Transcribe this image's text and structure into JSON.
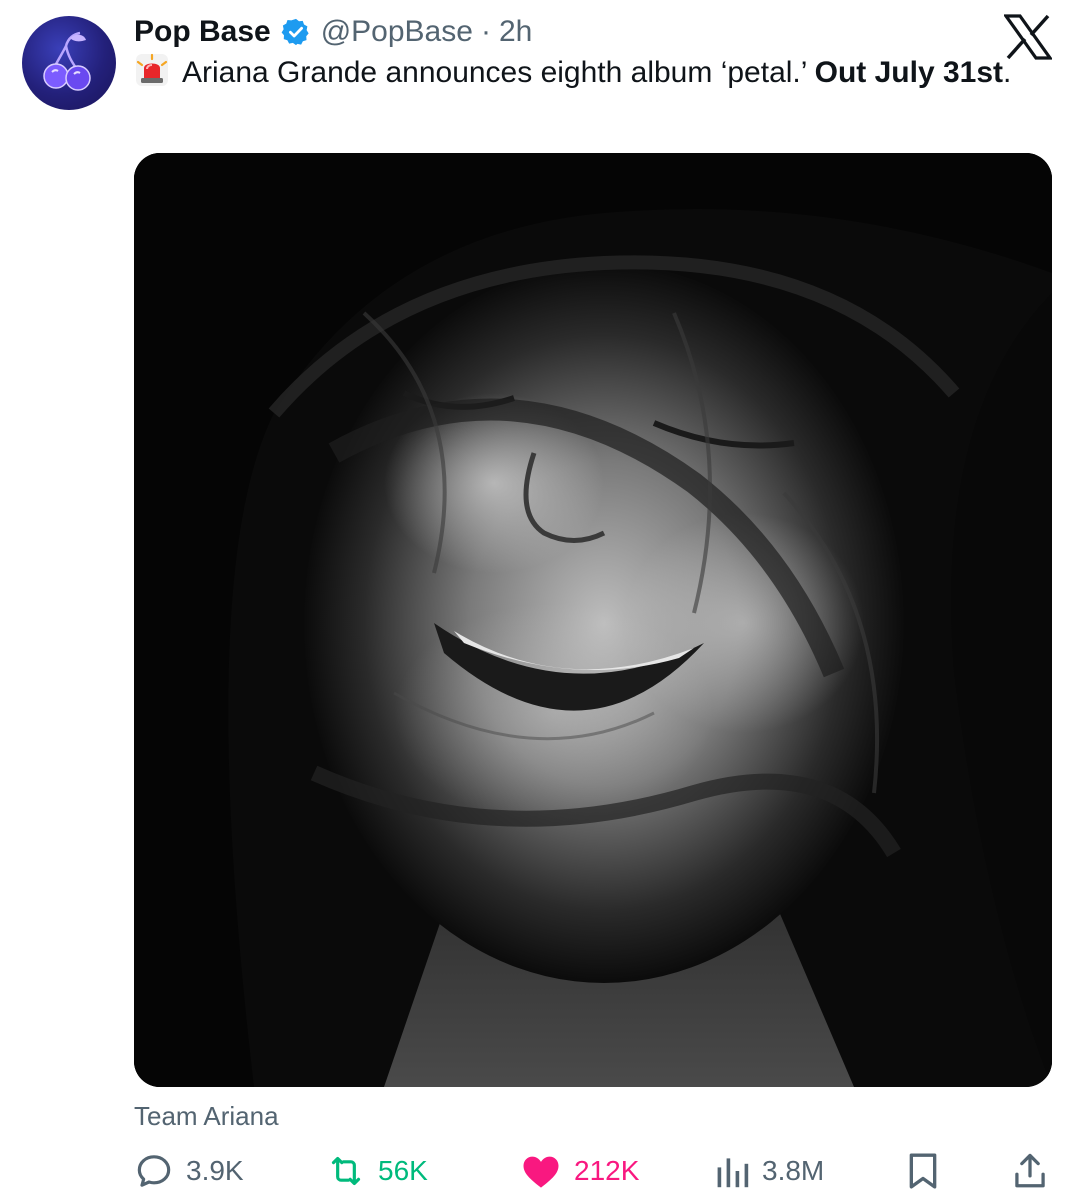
{
  "author": {
    "display_name": "Pop Base",
    "handle": "@PopBase",
    "separator": "·",
    "time": "2h",
    "avatar_icon": "cherry-icon",
    "verified_icon": "verified-badge-icon"
  },
  "platform": {
    "logo_icon": "x-logo-icon"
  },
  "tweet": {
    "emoji_icon": "police-siren-icon",
    "text_plain": "Ariana Grande announces eighth album ‘petal.’ ",
    "text_bold_1": "Out July 31st",
    "text_end": "."
  },
  "media": {
    "alt_subject": "black-and-white close-up portrait of a smiling woman with hair across her face",
    "attribution": "Team Ariana"
  },
  "actions": {
    "reply": {
      "icon": "reply-icon",
      "count": "3.9K"
    },
    "retweet": {
      "icon": "retweet-icon",
      "count": "56K",
      "color": "#00ba7c"
    },
    "like": {
      "icon": "heart-icon",
      "count": "212K",
      "color": "#f91880"
    },
    "views": {
      "icon": "views-icon",
      "count": "3.8M"
    },
    "bookmark": {
      "icon": "bookmark-icon"
    },
    "share": {
      "icon": "share-icon"
    }
  }
}
